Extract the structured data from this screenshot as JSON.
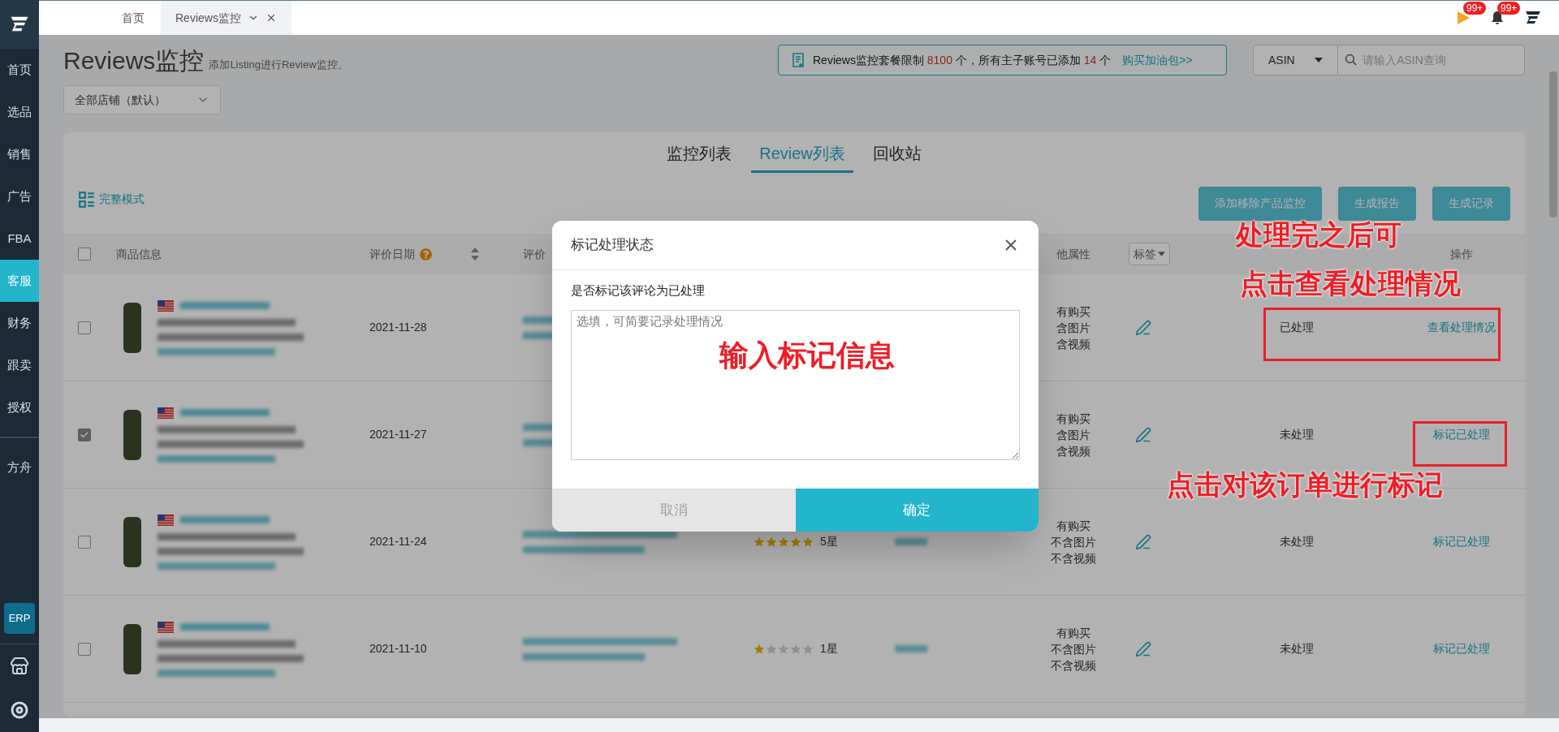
{
  "sidebar": {
    "main_items": [
      {
        "label": "首页",
        "selected": false
      },
      {
        "label": "选品",
        "selected": false
      },
      {
        "label": "销售",
        "selected": false
      },
      {
        "label": "广告",
        "selected": false
      },
      {
        "label": "FBA",
        "selected": false
      },
      {
        "label": "客服",
        "selected": true
      },
      {
        "label": "财务",
        "selected": false
      },
      {
        "label": "跟卖",
        "selected": false
      },
      {
        "label": "授权",
        "selected": false
      }
    ],
    "extra_items": [
      {
        "label": "方舟",
        "selected": false
      }
    ],
    "erp_button": "ERP"
  },
  "tabs": [
    {
      "label": "首页",
      "selected": false,
      "closable": false
    },
    {
      "label": "Reviews监控",
      "selected": true,
      "closable": true
    }
  ],
  "notifications": [
    {
      "kind": "flag",
      "badge": "99+"
    },
    {
      "kind": "bell",
      "badge": "99+"
    }
  ],
  "header": {
    "title": "Reviews监控",
    "subtitle": "添加Listing进行Review监控。",
    "store_select": "全部店铺（默认）"
  },
  "quota": {
    "prefix": "Reviews监控套餐限制",
    "limit": "8100",
    "middle": "个，所有主子账号已添加",
    "added": "14",
    "suffix": "个",
    "link": "购买加油包>>"
  },
  "search": {
    "type_select": "ASIN",
    "placeholder": "请输入ASIN查询"
  },
  "view_tabs": [
    {
      "label": "监控列表",
      "selected": false
    },
    {
      "label": "Review列表",
      "selected": true
    },
    {
      "label": "回收站",
      "selected": false
    }
  ],
  "mode_toggle": "完整模式",
  "actions": [
    "添加移除产品监控",
    "生成报告",
    "生成记录"
  ],
  "table": {
    "select_all": {
      "checked": false
    },
    "columns": {
      "product": "商品信息",
      "date": "评价日期",
      "review": "评价",
      "attributes": "他属性",
      "tag": "标签",
      "operation": "操作"
    },
    "rows": [
      {
        "checked": false,
        "date": "2021-11-28",
        "attributes": [
          "有购买",
          "含图片",
          "含视频"
        ],
        "status": "已处理",
        "action": "查看处理情况"
      },
      {
        "checked": true,
        "date": "2021-11-27",
        "attributes": [
          "有购买",
          "含图片",
          "含视频"
        ],
        "status": "未处理",
        "action": "标记已处理"
      },
      {
        "checked": false,
        "date": "2021-11-24",
        "rating": {
          "stars": 5,
          "label": "5星"
        },
        "attributes": [
          "有购买",
          "不含图片",
          "不含视频"
        ],
        "status": "未处理",
        "action": "标记已处理"
      },
      {
        "checked": false,
        "date": "2021-11-10",
        "rating": {
          "stars": 1,
          "label": "1星"
        },
        "attributes": [
          "有购买",
          "不含图片",
          "不含视频"
        ],
        "status": "未处理",
        "action": "标记已处理"
      }
    ]
  },
  "modal": {
    "title": "标记处理状态",
    "question": "是否标记该评论为已处理",
    "placeholder": "选填，可简要记录处理情况",
    "cancel": "取消",
    "confirm": "确定"
  },
  "annotations": [
    "处理完之后可",
    "点击查看处理情况",
    "输入标记信息",
    "点击对该订单进行标记"
  ]
}
